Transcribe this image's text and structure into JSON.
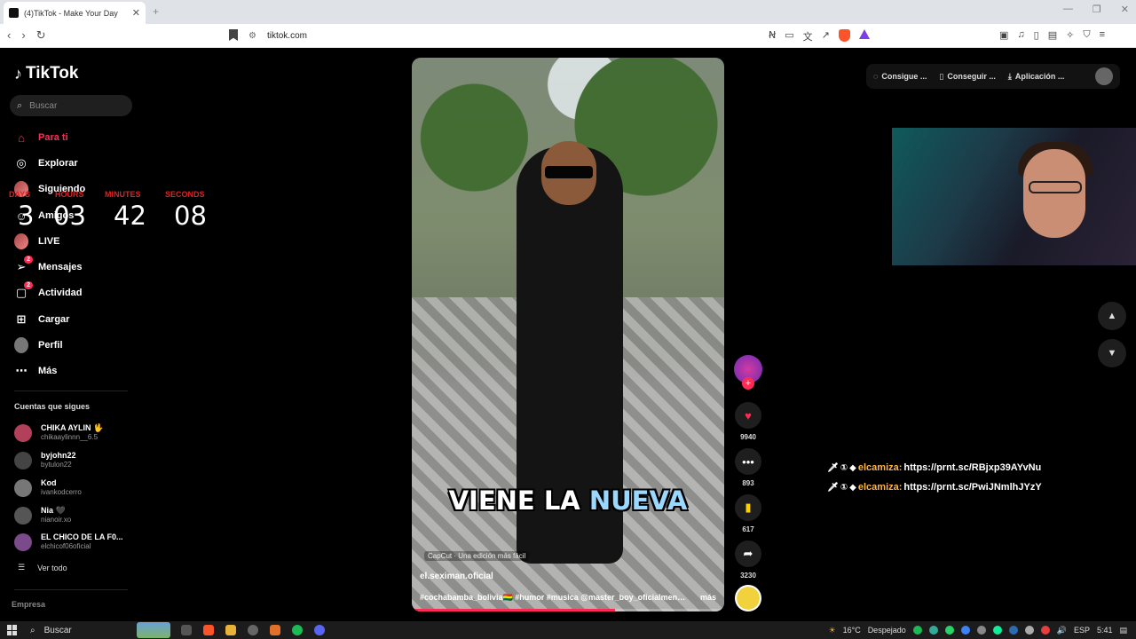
{
  "browser": {
    "tab_title": "(4)TikTok - Make Your Day",
    "url": "tiktok.com"
  },
  "app": {
    "name": "TikTok"
  },
  "search": {
    "placeholder": "Buscar"
  },
  "nav": [
    {
      "label": "Para ti",
      "icon": "home-icon"
    },
    {
      "label": "Explorar",
      "icon": "compass-icon"
    },
    {
      "label": "Siguiendo",
      "icon": "following-icon"
    },
    {
      "label": "Amigos",
      "icon": "friends-icon"
    },
    {
      "label": "LIVE",
      "icon": "live-icon"
    },
    {
      "label": "Mensajes",
      "icon": "messages-icon",
      "badge": "2"
    },
    {
      "label": "Actividad",
      "icon": "activity-icon",
      "badge": "2"
    },
    {
      "label": "Cargar",
      "icon": "upload-icon"
    },
    {
      "label": "Perfil",
      "icon": "profile-icon"
    },
    {
      "label": "Más",
      "icon": "more-icon"
    }
  ],
  "countdown": {
    "labels": [
      "DAYS",
      "HOURS",
      "MINUTES",
      "SECONDS"
    ],
    "values": [
      "3",
      "03",
      "42",
      "08"
    ]
  },
  "following": {
    "title": "Cuentas que sigues",
    "accounts": [
      {
        "name": "CHIKA AYLIN 🖖",
        "handle": "chikaaylinnn__6.5",
        "color": "#b3405a"
      },
      {
        "name": "byjohn22",
        "handle": "bytulon22",
        "color": "#444"
      },
      {
        "name": "Kod",
        "handle": "ivankodcerro",
        "color": "#777"
      },
      {
        "name": "Nia 🖤",
        "handle": "nianoir.xo",
        "color": "#555"
      },
      {
        "name": "EL CHICO DE LA F0...",
        "handle": "elchicof06oficial",
        "color": "#7a4a8a"
      }
    ],
    "see_all": "Ver todo"
  },
  "footer": {
    "empresa": "Empresa"
  },
  "video": {
    "caption_part1": "VIENE LA ",
    "caption_highlight": "NUEVA",
    "capcut": "CapCut · Una edición más fácil",
    "author": "el.seximan.oficial",
    "description": "#cochabamba_bolivia🇧🇴 #humor #musica @master_boy_oficialment...",
    "more": "más",
    "progress": 0.65
  },
  "actions": {
    "likes": "9940",
    "comments": "893",
    "saves": "617",
    "shares": "3230"
  },
  "top_right": {
    "coins": "Consigue ...",
    "get": "Conseguir ...",
    "app": "Aplicación ..."
  },
  "chat": [
    {
      "user": "elcamiza:",
      "text": "https://prnt.sc/RBjxp39AYvNu"
    },
    {
      "user": "elcamiza:",
      "text": "https://prnt.sc/PwiJNmlhJYzY"
    }
  ],
  "taskbar": {
    "search": "Buscar",
    "weather": "16°C",
    "weather_desc": "Despejado",
    "lang": "ESP",
    "time": "5:41"
  }
}
